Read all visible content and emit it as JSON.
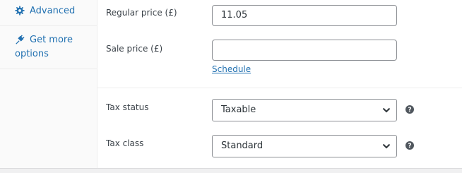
{
  "sidebar": {
    "advanced_label": "Advanced",
    "get_more_line1": "Get more",
    "get_more_line2": "options"
  },
  "pricing": {
    "regular_price_label": "Regular price (£)",
    "regular_price_value": "11.05",
    "sale_price_label": "Sale price (£)",
    "sale_price_value": "",
    "schedule_link": "Schedule"
  },
  "tax": {
    "status_label": "Tax status",
    "status_value": "Taxable",
    "class_label": "Tax class",
    "class_value": "Standard"
  },
  "colors": {
    "link": "#2271b1",
    "border": "#8c8f94",
    "help_icon": "#50575e"
  },
  "icons": {
    "advanced": "gear-icon",
    "get_more": "plug-icon",
    "select": "chevron-down-icon",
    "help": "help-icon"
  }
}
